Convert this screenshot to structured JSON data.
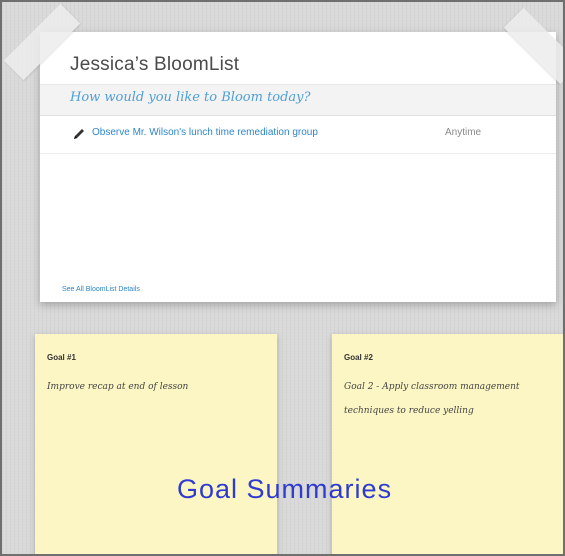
{
  "bloomlist": {
    "title": "Jessica’s BloomList",
    "prompt": "How would you like to Bloom today?",
    "task": {
      "icon": "pencil-icon",
      "label": "Observe Mr. Wilson's lunch time remediation group",
      "when": "Anytime"
    },
    "see_all_link": "See All BloomList Details"
  },
  "goals": [
    {
      "title": "Goal #1",
      "text": "Improve recap at end of lesson"
    },
    {
      "title": "Goal #2",
      "text": "Goal 2 - Apply classroom management techniques to reduce yelling"
    }
  ],
  "overlay_caption": "Goal Summaries",
  "colors": {
    "background": "#d9d9d9",
    "link_blue": "#2f86c8",
    "prompt_blue": "#4f9fd6",
    "note_yellow": "#fbf6c3",
    "caption_blue": "#2f3bd0"
  }
}
